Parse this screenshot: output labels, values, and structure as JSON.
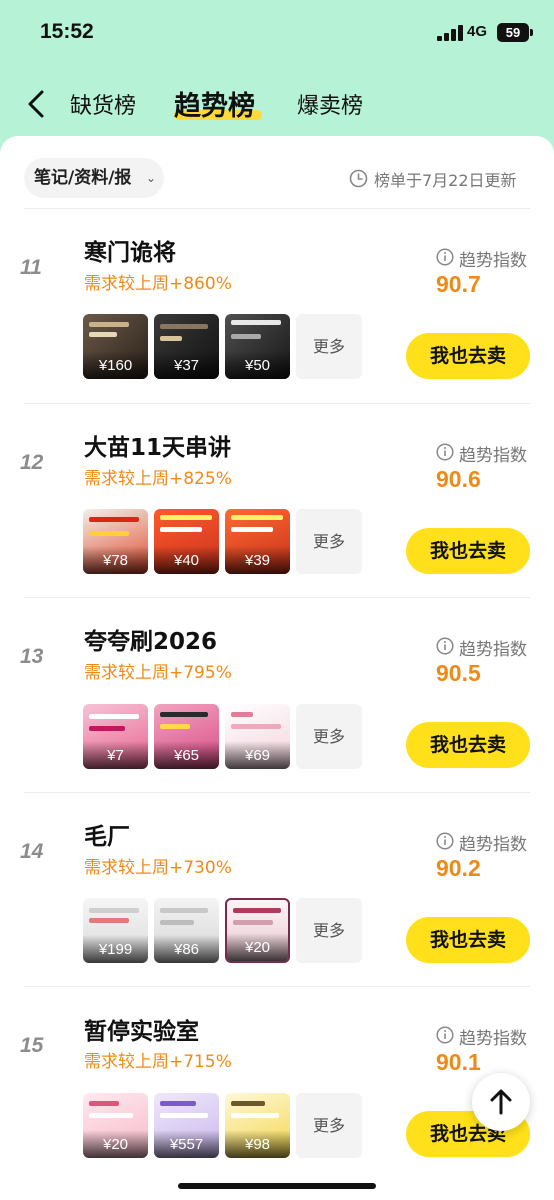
{
  "status_bar": {
    "time": "15:52",
    "network": "4G",
    "battery": "59"
  },
  "header": {
    "tabs": [
      {
        "label": "缺货榜"
      },
      {
        "label": "趋势榜",
        "active": true
      },
      {
        "label": "爆卖榜"
      }
    ]
  },
  "filter": {
    "label": "笔记/资料/报"
  },
  "update_note": "榜单于7月22日更新",
  "colors": {
    "accent": "#ffe01a",
    "growth": "#f08a17",
    "header_bg": "#b5f2d6"
  },
  "items": [
    {
      "rank": "11",
      "title": "寒门诡将",
      "growth": "需求较上周+860%",
      "index_label": "趋势指数",
      "index_value": "90.7",
      "thumbs": [
        {
          "price": "¥160"
        },
        {
          "price": "¥37"
        },
        {
          "price": "¥50"
        }
      ],
      "more_label": "更多",
      "sell_label": "我也去卖"
    },
    {
      "rank": "12",
      "title": "大苗11天串讲",
      "growth": "需求较上周+825%",
      "index_label": "趋势指数",
      "index_value": "90.6",
      "thumbs": [
        {
          "price": "¥78"
        },
        {
          "price": "¥40"
        },
        {
          "price": "¥39"
        }
      ],
      "more_label": "更多",
      "sell_label": "我也去卖"
    },
    {
      "rank": "13",
      "title": "夸夸刷2026",
      "growth": "需求较上周+795%",
      "index_label": "趋势指数",
      "index_value": "90.5",
      "thumbs": [
        {
          "price": "¥7"
        },
        {
          "price": "¥65"
        },
        {
          "price": "¥69"
        }
      ],
      "more_label": "更多",
      "sell_label": "我也去卖"
    },
    {
      "rank": "14",
      "title": "毛厂",
      "growth": "需求较上周+730%",
      "index_label": "趋势指数",
      "index_value": "90.2",
      "thumbs": [
        {
          "price": "¥199"
        },
        {
          "price": "¥86"
        },
        {
          "price": "¥20"
        }
      ],
      "more_label": "更多",
      "sell_label": "我也去卖"
    },
    {
      "rank": "15",
      "title": "暂停实验室",
      "growth": "需求较上周+715%",
      "index_label": "趋势指数",
      "index_value": "90.1",
      "thumbs": [
        {
          "price": "¥20"
        },
        {
          "price": "¥557"
        },
        {
          "price": "¥98"
        }
      ],
      "more_label": "更多",
      "sell_label": "我也去卖"
    }
  ]
}
